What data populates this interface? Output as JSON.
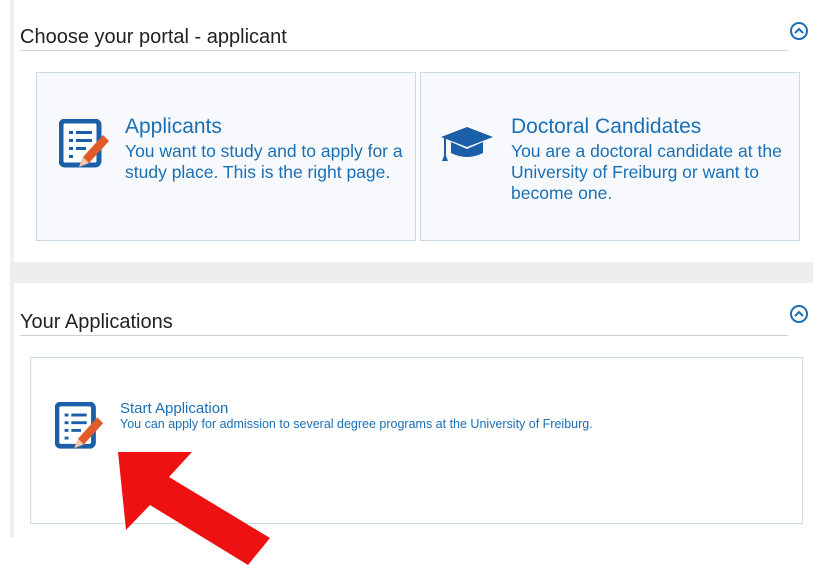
{
  "portal": {
    "title": "Choose your portal - applicant",
    "cards": [
      {
        "title": "Applicants",
        "description": "You want to study and to apply for a study place. This is the right page.",
        "icon": "application-form-icon"
      },
      {
        "title": "Doctoral Candidates",
        "description": "You are a doctoral candidate at the University of Freiburg or want to become one.",
        "icon": "graduation-cap-icon"
      }
    ]
  },
  "applications": {
    "title": "Your Applications",
    "card": {
      "title": "Start Application",
      "description": "You can apply for admission to several degree programs at the University of Freiburg.",
      "icon": "application-form-icon"
    }
  },
  "colors": {
    "link": "#1a6fb5",
    "icon_blue": "#1a5fa8",
    "pencil": "#e05a2a",
    "arrow": "#ee1111"
  }
}
